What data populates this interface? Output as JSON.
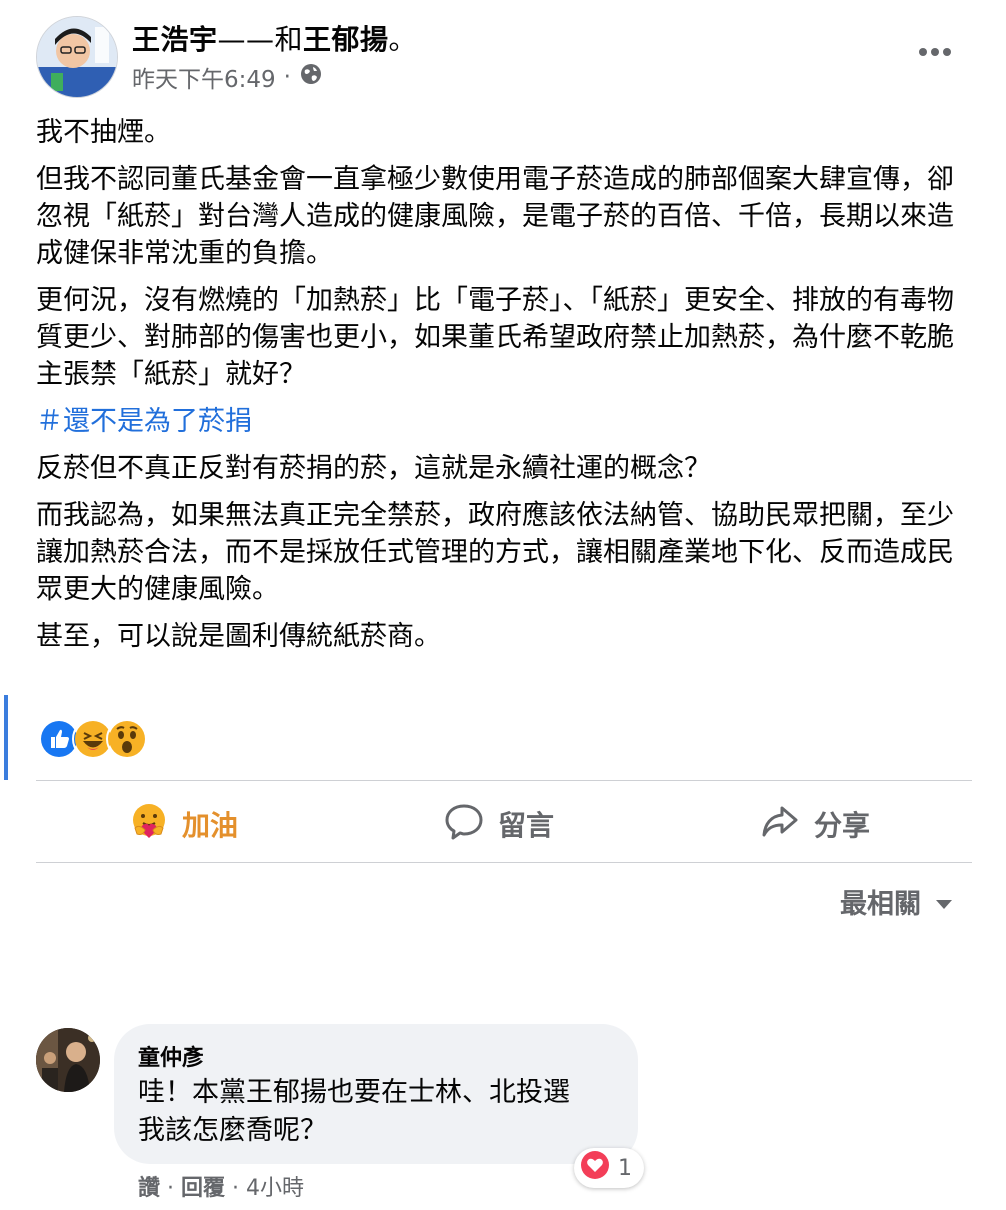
{
  "post": {
    "author_name": "王浩宇",
    "with_dash": "——",
    "with_word": "和",
    "with_name": "王郁揚",
    "with_suffix": "。",
    "timestamp": "昨天下午6:49",
    "dot": "·",
    "privacy_icon": "globe-icon",
    "paragraphs": [
      "我不抽煙。",
      "但我不認同董氏基金會一直拿極少數使用電子菸造成的肺部個案大肆宣傳，卻忽視「紙菸」對台灣人造成的健康風險，是電子菸的百倍、千倍，長期以來造成健保非常沈重的負擔。",
      "更何況，沒有燃燒的「加熱菸」比「電子菸」、「紙菸」更安全、排放的有毒物質更少、對肺部的傷害也更小，如果董氏希望政府禁止加熱菸，為什麼不乾脆主張禁「紙菸」就好？"
    ],
    "hashtag": "＃還不是為了菸捐",
    "paragraphs_after": [
      "反菸但不真正反對有菸捐的菸，這就是永續社運的概念？",
      "而我認為，如果無法真正完全禁菸，政府應該依法納管、協助民眾把關，至少讓加熱菸合法，而不是採放任式管理的方式，讓相關產業地下化、反而造成民眾更大的健康風險。",
      "甚至，可以說是圖利傳統紙菸商。"
    ],
    "reactions": [
      "like-reaction-icon",
      "haha-reaction-icon",
      "wow-reaction-icon"
    ]
  },
  "actions": {
    "cheer_label": "加油",
    "comment_label": "留言",
    "share_label": "分享"
  },
  "sort_label": "最相關",
  "comment": {
    "author": "童仲彥",
    "lines": [
      "哇！本黨王郁揚也要在士林、北投選",
      "我該怎麼喬呢？"
    ],
    "reaction_count": "1",
    "like_label": "讚",
    "reply_label": "回覆",
    "sep": " · ",
    "time": "4小時"
  },
  "colors": {
    "hashtag": "#216fdb",
    "cheer": "#e4902c",
    "muted": "#65676b"
  }
}
